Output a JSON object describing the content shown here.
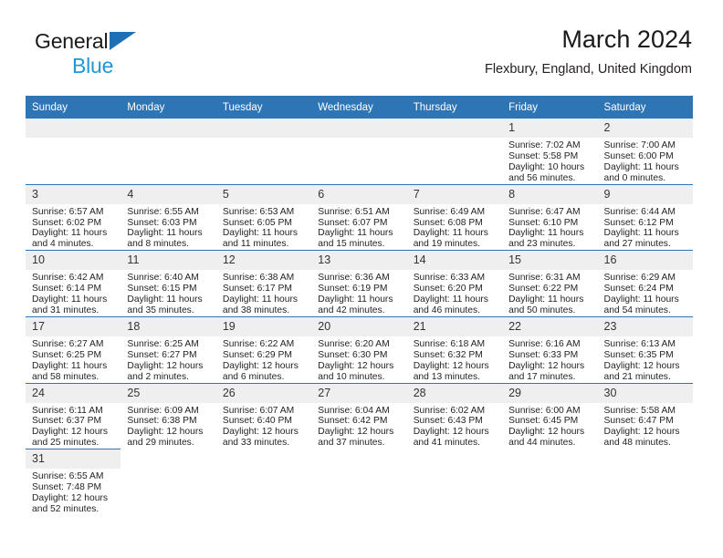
{
  "brand": {
    "line1": "General",
    "line2": "Blue",
    "triangle_color": "#1f6fb5",
    "blue_text_color": "#2196d6"
  },
  "header": {
    "title": "March 2024",
    "subtitle": "Flexbury, England, United Kingdom",
    "accent_color": "#2e75b6"
  },
  "calendar": {
    "weekday_headers": [
      "Sunday",
      "Monday",
      "Tuesday",
      "Wednesday",
      "Thursday",
      "Friday",
      "Saturday"
    ],
    "weeks": [
      [
        {
          "day": "",
          "sunrise": "",
          "sunset": "",
          "daylight_line1": "",
          "daylight_line2": "",
          "empty": true
        },
        {
          "day": "",
          "sunrise": "",
          "sunset": "",
          "daylight_line1": "",
          "daylight_line2": "",
          "empty": true
        },
        {
          "day": "",
          "sunrise": "",
          "sunset": "",
          "daylight_line1": "",
          "daylight_line2": "",
          "empty": true
        },
        {
          "day": "",
          "sunrise": "",
          "sunset": "",
          "daylight_line1": "",
          "daylight_line2": "",
          "empty": true
        },
        {
          "day": "",
          "sunrise": "",
          "sunset": "",
          "daylight_line1": "",
          "daylight_line2": "",
          "empty": true
        },
        {
          "day": "1",
          "sunrise": "Sunrise: 7:02 AM",
          "sunset": "Sunset: 5:58 PM",
          "daylight_line1": "Daylight: 10 hours",
          "daylight_line2": "and 56 minutes."
        },
        {
          "day": "2",
          "sunrise": "Sunrise: 7:00 AM",
          "sunset": "Sunset: 6:00 PM",
          "daylight_line1": "Daylight: 11 hours",
          "daylight_line2": "and 0 minutes."
        }
      ],
      [
        {
          "day": "3",
          "sunrise": "Sunrise: 6:57 AM",
          "sunset": "Sunset: 6:02 PM",
          "daylight_line1": "Daylight: 11 hours",
          "daylight_line2": "and 4 minutes."
        },
        {
          "day": "4",
          "sunrise": "Sunrise: 6:55 AM",
          "sunset": "Sunset: 6:03 PM",
          "daylight_line1": "Daylight: 11 hours",
          "daylight_line2": "and 8 minutes."
        },
        {
          "day": "5",
          "sunrise": "Sunrise: 6:53 AM",
          "sunset": "Sunset: 6:05 PM",
          "daylight_line1": "Daylight: 11 hours",
          "daylight_line2": "and 11 minutes."
        },
        {
          "day": "6",
          "sunrise": "Sunrise: 6:51 AM",
          "sunset": "Sunset: 6:07 PM",
          "daylight_line1": "Daylight: 11 hours",
          "daylight_line2": "and 15 minutes."
        },
        {
          "day": "7",
          "sunrise": "Sunrise: 6:49 AM",
          "sunset": "Sunset: 6:08 PM",
          "daylight_line1": "Daylight: 11 hours",
          "daylight_line2": "and 19 minutes."
        },
        {
          "day": "8",
          "sunrise": "Sunrise: 6:47 AM",
          "sunset": "Sunset: 6:10 PM",
          "daylight_line1": "Daylight: 11 hours",
          "daylight_line2": "and 23 minutes."
        },
        {
          "day": "9",
          "sunrise": "Sunrise: 6:44 AM",
          "sunset": "Sunset: 6:12 PM",
          "daylight_line1": "Daylight: 11 hours",
          "daylight_line2": "and 27 minutes."
        }
      ],
      [
        {
          "day": "10",
          "sunrise": "Sunrise: 6:42 AM",
          "sunset": "Sunset: 6:14 PM",
          "daylight_line1": "Daylight: 11 hours",
          "daylight_line2": "and 31 minutes."
        },
        {
          "day": "11",
          "sunrise": "Sunrise: 6:40 AM",
          "sunset": "Sunset: 6:15 PM",
          "daylight_line1": "Daylight: 11 hours",
          "daylight_line2": "and 35 minutes."
        },
        {
          "day": "12",
          "sunrise": "Sunrise: 6:38 AM",
          "sunset": "Sunset: 6:17 PM",
          "daylight_line1": "Daylight: 11 hours",
          "daylight_line2": "and 38 minutes."
        },
        {
          "day": "13",
          "sunrise": "Sunrise: 6:36 AM",
          "sunset": "Sunset: 6:19 PM",
          "daylight_line1": "Daylight: 11 hours",
          "daylight_line2": "and 42 minutes."
        },
        {
          "day": "14",
          "sunrise": "Sunrise: 6:33 AM",
          "sunset": "Sunset: 6:20 PM",
          "daylight_line1": "Daylight: 11 hours",
          "daylight_line2": "and 46 minutes."
        },
        {
          "day": "15",
          "sunrise": "Sunrise: 6:31 AM",
          "sunset": "Sunset: 6:22 PM",
          "daylight_line1": "Daylight: 11 hours",
          "daylight_line2": "and 50 minutes."
        },
        {
          "day": "16",
          "sunrise": "Sunrise: 6:29 AM",
          "sunset": "Sunset: 6:24 PM",
          "daylight_line1": "Daylight: 11 hours",
          "daylight_line2": "and 54 minutes."
        }
      ],
      [
        {
          "day": "17",
          "sunrise": "Sunrise: 6:27 AM",
          "sunset": "Sunset: 6:25 PM",
          "daylight_line1": "Daylight: 11 hours",
          "daylight_line2": "and 58 minutes."
        },
        {
          "day": "18",
          "sunrise": "Sunrise: 6:25 AM",
          "sunset": "Sunset: 6:27 PM",
          "daylight_line1": "Daylight: 12 hours",
          "daylight_line2": "and 2 minutes."
        },
        {
          "day": "19",
          "sunrise": "Sunrise: 6:22 AM",
          "sunset": "Sunset: 6:29 PM",
          "daylight_line1": "Daylight: 12 hours",
          "daylight_line2": "and 6 minutes."
        },
        {
          "day": "20",
          "sunrise": "Sunrise: 6:20 AM",
          "sunset": "Sunset: 6:30 PM",
          "daylight_line1": "Daylight: 12 hours",
          "daylight_line2": "and 10 minutes."
        },
        {
          "day": "21",
          "sunrise": "Sunrise: 6:18 AM",
          "sunset": "Sunset: 6:32 PM",
          "daylight_line1": "Daylight: 12 hours",
          "daylight_line2": "and 13 minutes."
        },
        {
          "day": "22",
          "sunrise": "Sunrise: 6:16 AM",
          "sunset": "Sunset: 6:33 PM",
          "daylight_line1": "Daylight: 12 hours",
          "daylight_line2": "and 17 minutes."
        },
        {
          "day": "23",
          "sunrise": "Sunrise: 6:13 AM",
          "sunset": "Sunset: 6:35 PM",
          "daylight_line1": "Daylight: 12 hours",
          "daylight_line2": "and 21 minutes."
        }
      ],
      [
        {
          "day": "24",
          "sunrise": "Sunrise: 6:11 AM",
          "sunset": "Sunset: 6:37 PM",
          "daylight_line1": "Daylight: 12 hours",
          "daylight_line2": "and 25 minutes."
        },
        {
          "day": "25",
          "sunrise": "Sunrise: 6:09 AM",
          "sunset": "Sunset: 6:38 PM",
          "daylight_line1": "Daylight: 12 hours",
          "daylight_line2": "and 29 minutes."
        },
        {
          "day": "26",
          "sunrise": "Sunrise: 6:07 AM",
          "sunset": "Sunset: 6:40 PM",
          "daylight_line1": "Daylight: 12 hours",
          "daylight_line2": "and 33 minutes."
        },
        {
          "day": "27",
          "sunrise": "Sunrise: 6:04 AM",
          "sunset": "Sunset: 6:42 PM",
          "daylight_line1": "Daylight: 12 hours",
          "daylight_line2": "and 37 minutes."
        },
        {
          "day": "28",
          "sunrise": "Sunrise: 6:02 AM",
          "sunset": "Sunset: 6:43 PM",
          "daylight_line1": "Daylight: 12 hours",
          "daylight_line2": "and 41 minutes."
        },
        {
          "day": "29",
          "sunrise": "Sunrise: 6:00 AM",
          "sunset": "Sunset: 6:45 PM",
          "daylight_line1": "Daylight: 12 hours",
          "daylight_line2": "and 44 minutes."
        },
        {
          "day": "30",
          "sunrise": "Sunrise: 5:58 AM",
          "sunset": "Sunset: 6:47 PM",
          "daylight_line1": "Daylight: 12 hours",
          "daylight_line2": "and 48 minutes."
        }
      ],
      [
        {
          "day": "31",
          "sunrise": "Sunrise: 6:55 AM",
          "sunset": "Sunset: 7:48 PM",
          "daylight_line1": "Daylight: 12 hours",
          "daylight_line2": "and 52 minutes."
        },
        {
          "day": "",
          "sunrise": "",
          "sunset": "",
          "daylight_line1": "",
          "daylight_line2": "",
          "blank": true
        },
        {
          "day": "",
          "sunrise": "",
          "sunset": "",
          "daylight_line1": "",
          "daylight_line2": "",
          "blank": true
        },
        {
          "day": "",
          "sunrise": "",
          "sunset": "",
          "daylight_line1": "",
          "daylight_line2": "",
          "blank": true
        },
        {
          "day": "",
          "sunrise": "",
          "sunset": "",
          "daylight_line1": "",
          "daylight_line2": "",
          "blank": true
        },
        {
          "day": "",
          "sunrise": "",
          "sunset": "",
          "daylight_line1": "",
          "daylight_line2": "",
          "blank": true
        },
        {
          "day": "",
          "sunrise": "",
          "sunset": "",
          "daylight_line1": "",
          "daylight_line2": "",
          "blank": true
        }
      ]
    ]
  }
}
